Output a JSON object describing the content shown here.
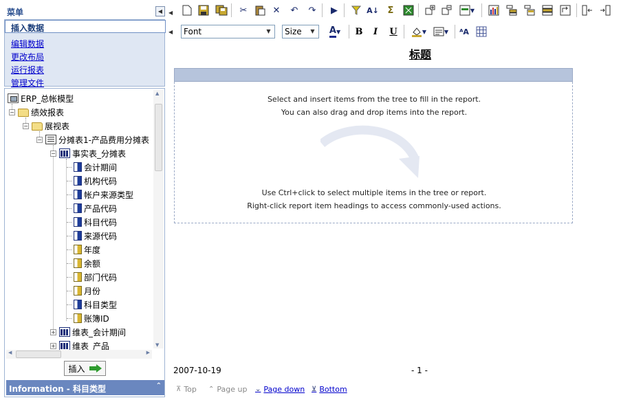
{
  "menu": {
    "title": "菜单",
    "items": [
      {
        "label": "插入数据"
      },
      {
        "label": "编辑数据"
      },
      {
        "label": "更改布局"
      },
      {
        "label": "运行报表"
      },
      {
        "label": "管理文件"
      }
    ]
  },
  "tree": {
    "nodes": [
      {
        "label": "ERP_总帐模型",
        "icon": "model-icon"
      },
      {
        "label": "绩效报表",
        "icon": "folder-icon"
      },
      {
        "label": "展视表",
        "icon": "folder-icon"
      },
      {
        "label": "分摊表1-产品费用分摊表",
        "icon": "report-icon"
      },
      {
        "label": "事实表_分摊表",
        "icon": "table-icon"
      },
      {
        "label": "会计期间",
        "icon": "dimension-icon"
      },
      {
        "label": "机构代码",
        "icon": "dimension-icon"
      },
      {
        "label": "帐户来源类型",
        "icon": "dimension-icon"
      },
      {
        "label": "产品代码",
        "icon": "dimension-icon"
      },
      {
        "label": "科目代码",
        "icon": "dimension-icon"
      },
      {
        "label": "来源代码",
        "icon": "dimension-icon"
      },
      {
        "label": "年度",
        "icon": "measure-icon"
      },
      {
        "label": "余额",
        "icon": "measure-icon"
      },
      {
        "label": "部门代码",
        "icon": "measure-icon"
      },
      {
        "label": "月份",
        "icon": "measure-icon"
      },
      {
        "label": "科目类型",
        "icon": "dimension-icon"
      },
      {
        "label": "账簿ID",
        "icon": "measure-icon"
      },
      {
        "label": "维表_会计期间",
        "icon": "table-icon"
      },
      {
        "label": "维表_产品",
        "icon": "table-icon"
      }
    ],
    "insert_label": "插入"
  },
  "info_bar": {
    "label": "Information - 科目类型"
  },
  "format_toolbar": {
    "font_value": "Font",
    "size_value": "Size",
    "bold": "B",
    "italic": "I",
    "underline": "U"
  },
  "report": {
    "title": "标题",
    "hint_1": "Select and insert items from the tree to fill in the report.",
    "hint_2": "You can also drag and drop items into the report.",
    "hint_3": "Use Ctrl+click to select multiple items in the tree or report.",
    "hint_4": "Right-click report item headings to access commonly-used actions.",
    "date": "2007-10-19",
    "page_number": "- 1 -"
  },
  "pager": {
    "top": "Top",
    "page_up": "Page up",
    "page_down": "Page down",
    "bottom": "Bottom"
  },
  "colors": {
    "menu_bg": "#dfe7f3",
    "info_bar": "#6a87bf",
    "band": "#b6c4dc",
    "link": "#0000cc"
  }
}
